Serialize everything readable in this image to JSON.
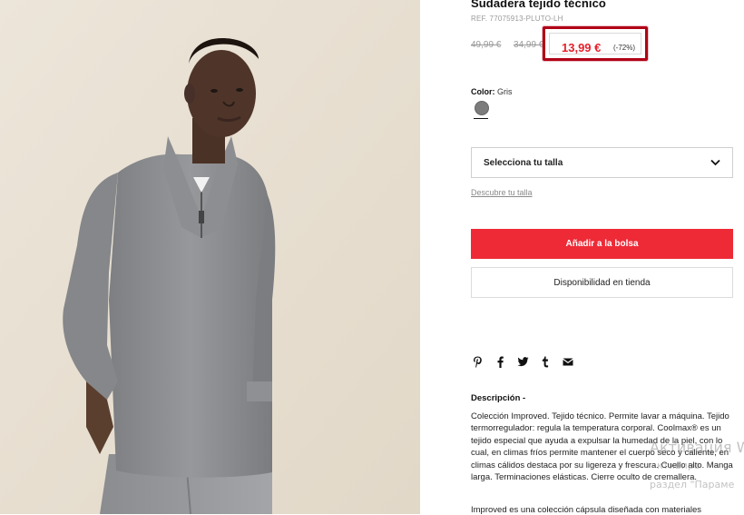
{
  "product": {
    "title": "Sudadera tejido técnico",
    "reference": "REF. 77075913-PLUTO-LH",
    "prices": {
      "original": "49,99 €",
      "previous": "34,99 €",
      "current": "13,99 €",
      "discount": "(-72%)"
    },
    "color": {
      "label": "Color:",
      "value": "Gris",
      "swatch_hex": "#7c7c7c"
    },
    "size_select": {
      "placeholder": "Selecciona tu talla",
      "icon": "chevron-down-icon"
    },
    "size_guide_link": "Descubre tu talla",
    "add_to_bag_label": "Añadir a la bolsa",
    "store_availability_label": "Disponibilidad en tienda",
    "share_icons": [
      "pinterest-icon",
      "facebook-icon",
      "twitter-icon",
      "tumblr-icon",
      "email-icon"
    ],
    "description": {
      "title": "Descripción",
      "paragraph": "Colección Improved. Tejido técnico. Permite lavar a máquina. Tejido termorregulador: regula la temperatura corporal. Coolmax® es un tejido especial que ayuda a expulsar la humedad de la piel, con lo cual, en climas fríos permite mantener el cuerpo seco y caliente, en climas cálidos destaca por su ligereza y frescura. Cuello alto. Manga larga. Terminaciones elásticas. Cierre oculto de cremallera.",
      "extra": "Improved es una colección cápsula diseñada con materiales"
    }
  },
  "colors": {
    "accent_red": "#ee2a37",
    "price_red": "#e6202b",
    "highlight_border": "#b00016"
  },
  "watermark": {
    "line1": "Активация W",
    "line2": "ктивиро",
    "line3": "раздел \"Параме"
  }
}
